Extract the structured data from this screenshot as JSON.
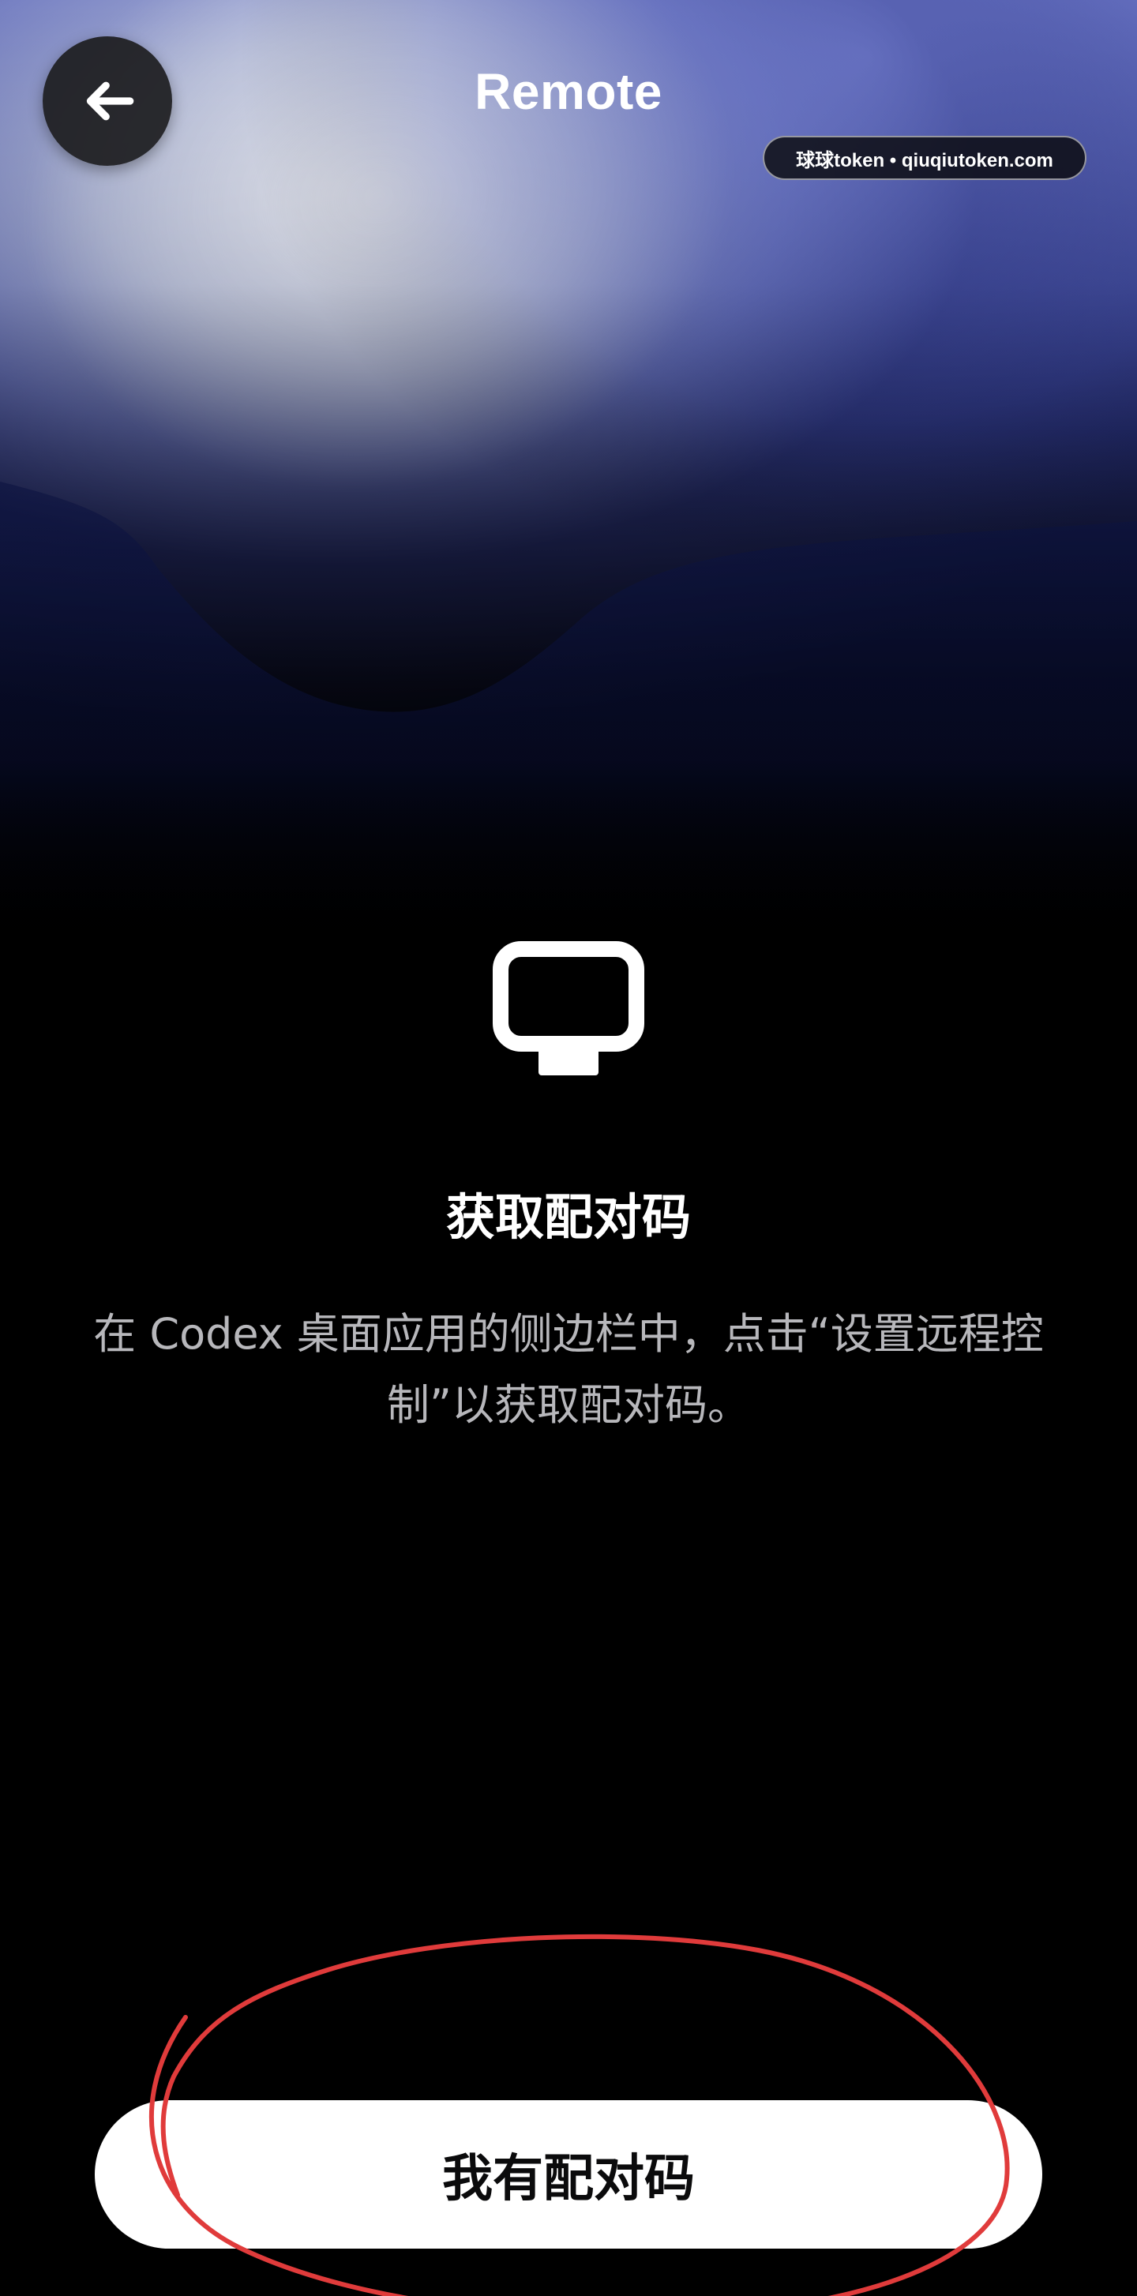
{
  "header": {
    "title": "Remote",
    "back_icon": "arrow-left-icon"
  },
  "watermark": {
    "text": "球球token • qiuqiutoken.com"
  },
  "content": {
    "icon": "monitor-icon",
    "heading": "获取配对码",
    "description": "在 Codex 桌面应用的侧边栏中，点击“设置远程控制”以获取配对码。"
  },
  "actions": {
    "primary_label": "我有配对码"
  },
  "colors": {
    "background": "#000000",
    "button_bg": "#FFFFFF",
    "button_text": "#0B0B0C",
    "annotation": "#E03B3B",
    "back_button_bg": "#1C1C1E"
  }
}
